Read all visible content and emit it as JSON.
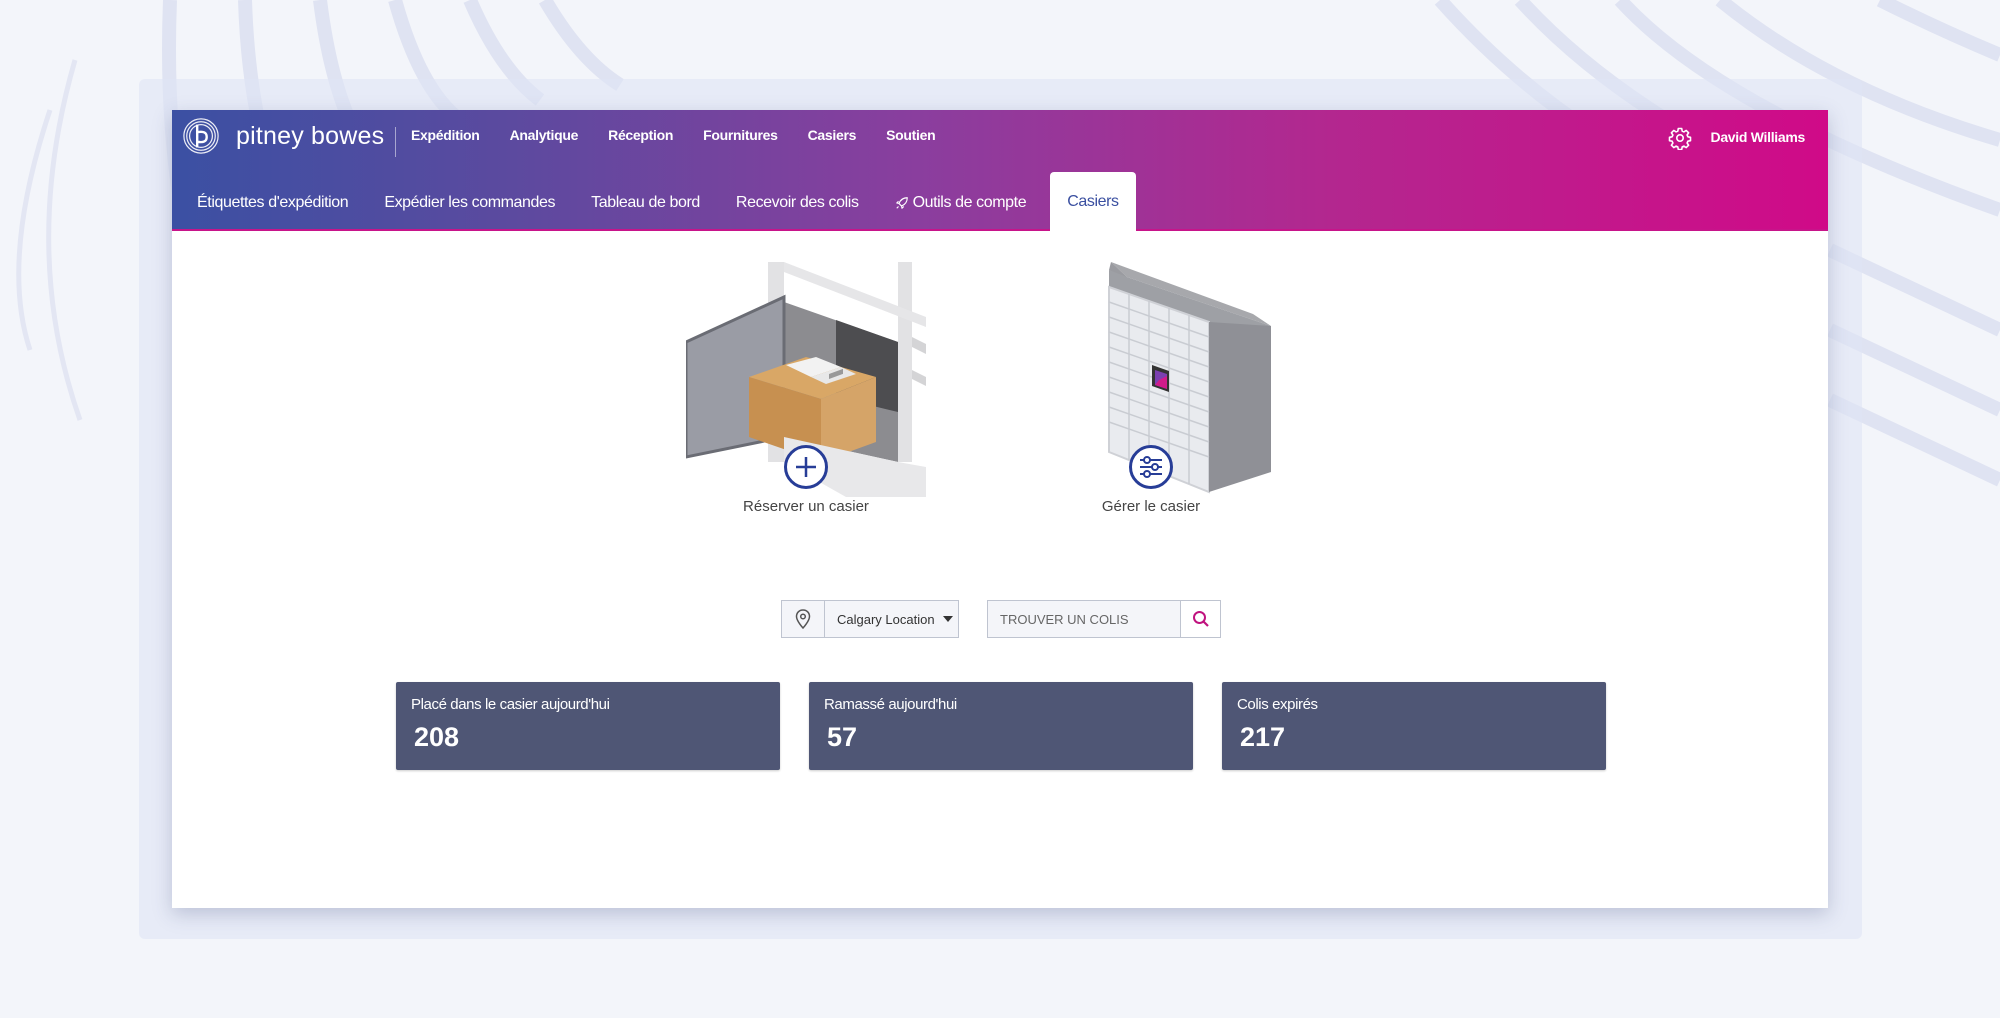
{
  "brand": {
    "name": "pitney bowes",
    "logo_icon": "pitney-bowes-logo"
  },
  "top_nav": {
    "items": [
      {
        "label": "Expédition"
      },
      {
        "label": "Analytique"
      },
      {
        "label": "Réception"
      },
      {
        "label": "Fournitures"
      },
      {
        "label": "Casiers"
      },
      {
        "label": "Soutien"
      }
    ],
    "settings_icon": "gear-icon",
    "user_name": "David Williams"
  },
  "sub_nav": {
    "items": [
      {
        "label": "Étiquettes d'expédition",
        "active": false
      },
      {
        "label": "Expédier les commandes",
        "active": false
      },
      {
        "label": "Tableau de bord",
        "active": false
      },
      {
        "label": "Recevoir des colis",
        "active": false
      },
      {
        "label": "Outils de compte",
        "active": false,
        "icon": "rocket-icon"
      },
      {
        "label": "Casiers",
        "active": true
      }
    ]
  },
  "actions": {
    "reserve": {
      "label": "Réserver un casier",
      "icon": "plus-circle-icon"
    },
    "manage": {
      "label": "Gérer le casier",
      "icon": "sliders-circle-icon"
    }
  },
  "filters": {
    "location_icon": "map-pin-icon",
    "location_value": "Calgary Location",
    "search_placeholder": "TROUVER UN COLIS",
    "search_value": "",
    "search_icon": "search-icon"
  },
  "stats": [
    {
      "title": "Placé dans le casier aujourd'hui",
      "value": "208"
    },
    {
      "title": "Ramassé aujourd'hui",
      "value": "57"
    },
    {
      "title": "Colis expirés",
      "value": "217"
    }
  ],
  "colors": {
    "header_gradient_start": "#3b50a3",
    "header_gradient_end": "#d00a88",
    "active_tab_text": "#3a4fa0",
    "stat_card_bg": "#4f5675",
    "icon_accent": "#273d97",
    "search_icon": "#c0137f"
  }
}
